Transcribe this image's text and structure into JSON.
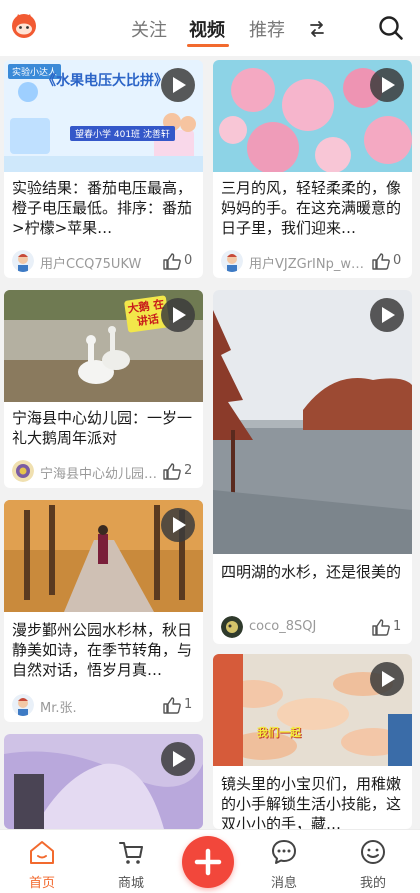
{
  "header": {
    "tabs": [
      {
        "label": "关注",
        "active": false
      },
      {
        "label": "视频",
        "active": true
      },
      {
        "label": "推荐",
        "active": false
      }
    ]
  },
  "cards": [
    {
      "overlay_text": "《水果电压大比拼》",
      "overlay_tag": "实验小达人",
      "overlay_sub": "望春小学 401班 沈善轩",
      "title": "实验结果：番茄电压最高，橙子电压最低。排序：番茄>柠檬>苹果…",
      "author": "用户CCQ75UKW",
      "likes": "0"
    },
    {
      "title": "三月的风，轻轻柔柔的，像妈妈的手。在这充满暖意的日子里，我们迎来…",
      "author": "用户VJZGrINp_w…",
      "likes": "0"
    },
    {
      "overlay_text": "大鹅 在讲话",
      "title": "宁海县中心幼儿园：一岁一礼大鹅周年派对",
      "author": "宁海县中心幼儿园…",
      "likes": "2"
    },
    {
      "title": "四明湖的水杉，还是很美的",
      "author": "coco_8SQJ",
      "likes": "1"
    },
    {
      "title": "漫步鄞州公园水杉林，秋日静美如诗，在季节转角，与自然对话，悟岁月真…",
      "author": "Mr.张.",
      "likes": "1"
    },
    {
      "overlay_text": "我们一起",
      "title": "镜头里的小宝贝们，用稚嫩的小手解锁生活小技能，这双小小的手，藏…"
    },
    {}
  ],
  "bottom_nav": {
    "items": [
      {
        "label": "首页",
        "icon": "home-icon",
        "active": true
      },
      {
        "label": "商城",
        "icon": "cart-icon"
      },
      {
        "label": "消息",
        "icon": "message-icon"
      },
      {
        "label": "我的",
        "icon": "profile-icon"
      }
    ]
  },
  "colors": {
    "accent": "#f26a2e",
    "publish": "#f2473b"
  }
}
